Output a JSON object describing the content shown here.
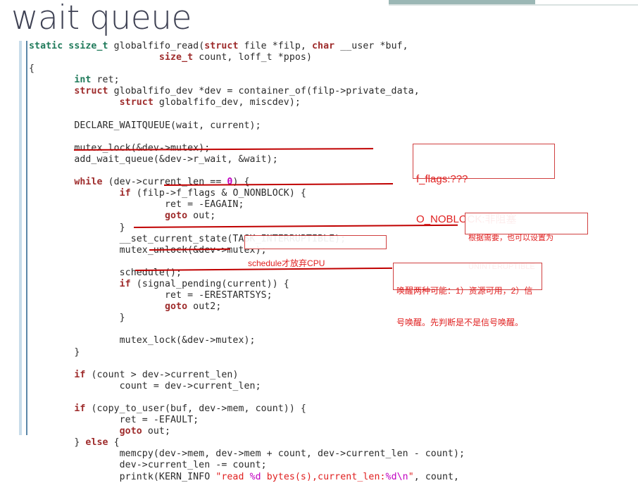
{
  "slide": {
    "title": "wait queue",
    "accent_color": "#9bb7b5",
    "title_color": "#3f4254",
    "annotation_color": "#e02020"
  },
  "code": {
    "language": "c",
    "lines": [
      "static ssize_t globalfifo_read(struct file *filp, char __user *buf,",
      "                       size_t count, loff_t *ppos)",
      "{",
      "        int ret;",
      "        struct globalfifo_dev *dev = container_of(filp->private_data,",
      "                struct globalfifo_dev, miscdev);",
      "",
      "        DECLARE_WAITQUEUE(wait, current);",
      "",
      "        mutex_lock(&dev->mutex);",
      "        add_wait_queue(&dev->r_wait, &wait);",
      "",
      "        while (dev->current_len == 0) {",
      "                if (filp->f_flags & O_NONBLOCK) {",
      "                        ret = -EAGAIN;",
      "                        goto out;",
      "                }",
      "                __set_current_state(TASK_INTERRUPTIBLE);",
      "                mutex_unlock(&dev->mutex);",
      "",
      "                schedule();",
      "                if (signal_pending(current)) {",
      "                        ret = -ERESTARTSYS;",
      "                        goto out2;",
      "                }",
      "",
      "                mutex_lock(&dev->mutex);",
      "        }",
      "",
      "        if (count > dev->current_len)",
      "                count = dev->current_len;",
      "",
      "        if (copy_to_user(buf, dev->mem, count)) {",
      "                ret = -EFAULT;",
      "                goto out;",
      "        } else {",
      "                memcpy(dev->mem, dev->mem + count, dev->current_len - count);",
      "                dev->current_len -= count;",
      "                printk(KERN_INFO \"read %d bytes(s),current_len:%d\\n\", count,"
    ],
    "keywords_green": [
      "static",
      "ssize_t",
      "int"
    ],
    "keywords_red": [
      "struct",
      "char",
      "size_t",
      "while",
      "if",
      "goto",
      "else"
    ],
    "literal_number": "0",
    "string_literal": "\"read %d bytes(s),current_len:%d\\n\""
  },
  "annotations": [
    {
      "id": "f-flags-note",
      "lines": [
        "f_flags:???",
        "O_NOBLOCK:非阻塞"
      ],
      "style": "large"
    },
    {
      "id": "uninterruptible-note",
      "lines": [
        "根据需要，也可以设置为",
        "UNINTERUPTIBLE"
      ],
      "style": "small"
    },
    {
      "id": "schedule-note",
      "lines": [
        "schedule才放弃CPU"
      ],
      "style": "mid"
    },
    {
      "id": "wakeup-note",
      "lines": [
        "唤醒两种可能：1）资源可用，2）信",
        "号唤醒。先判断是不是信号唤醒。"
      ],
      "style": "mid"
    }
  ],
  "marks": {
    "underline_add_wait_queue": "underline",
    "underline_o_nonblock": "underline",
    "strike_mutex_unlock": "strikethrough",
    "underline_schedule": "underline",
    "strike_erestartsys": "strikethrough"
  }
}
